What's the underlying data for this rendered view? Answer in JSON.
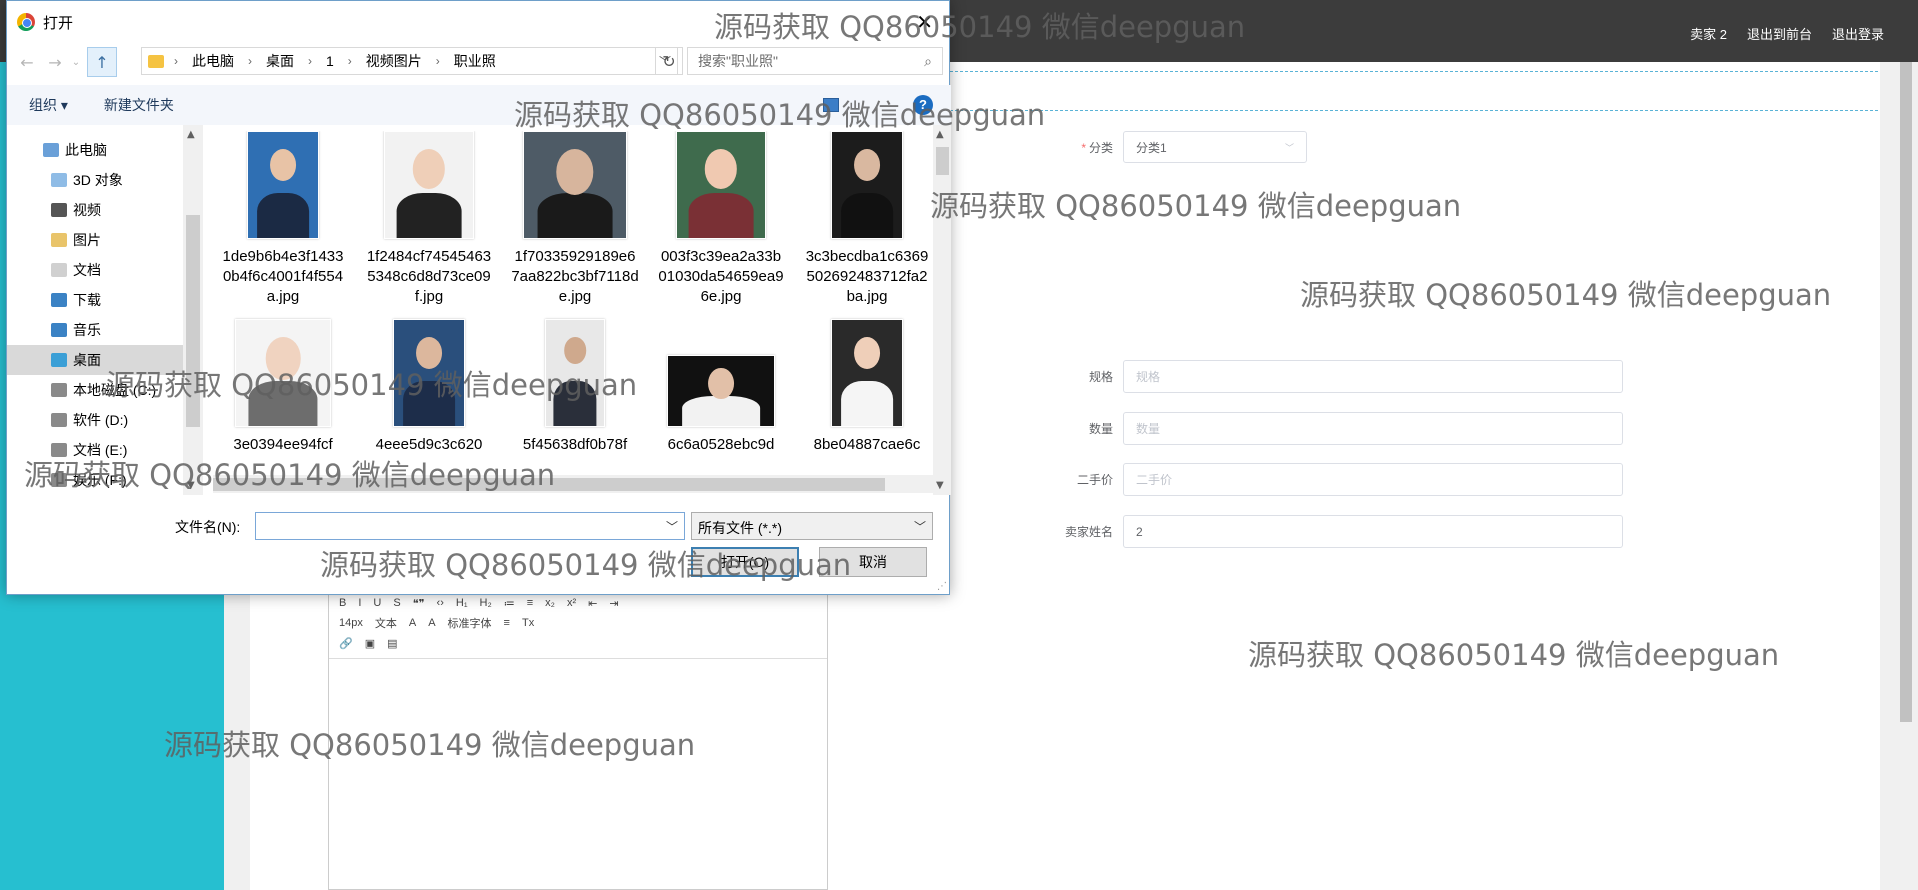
{
  "topbar": {
    "links": [
      "卖家 2",
      "退出到前台",
      "退出登录"
    ]
  },
  "form": {
    "category": {
      "label": "分类",
      "value": "分类1"
    },
    "spec": {
      "label": "规格",
      "placeholder": "规格"
    },
    "quantity": {
      "label": "数量",
      "placeholder": "数量"
    },
    "price": {
      "label": "二手价",
      "placeholder": "二手价"
    },
    "seller": {
      "label": "卖家姓名",
      "value": "2"
    }
  },
  "editor": {
    "row1": [
      "B",
      "I",
      "U",
      "S",
      "❝❞",
      "‹›",
      "H₁",
      "H₂",
      "≔",
      "≡",
      "x₂",
      "x²",
      "⇤",
      "⇥"
    ],
    "row2": [
      "14px",
      "文本",
      "A",
      "A",
      "标准字体",
      "≡",
      "Tx"
    ],
    "row3": [
      "🔗",
      "▣",
      "▤"
    ]
  },
  "dialog": {
    "title": "打开",
    "breadcrumb": [
      "此电脑",
      "桌面",
      "1",
      "视频图片",
      "职业照"
    ],
    "search_placeholder": "搜索\"职业照\"",
    "organize": "组织 ▾",
    "new_folder": "新建文件夹",
    "help": "?",
    "tree": [
      {
        "label": "此电脑",
        "sub": false,
        "color": "#6aa0d8"
      },
      {
        "label": "3D 对象",
        "sub": true,
        "color": "#8fbce6"
      },
      {
        "label": "视频",
        "sub": true,
        "color": "#555555"
      },
      {
        "label": "图片",
        "sub": true,
        "color": "#e9c46a"
      },
      {
        "label": "文档",
        "sub": true,
        "color": "#d0d0d0"
      },
      {
        "label": "下载",
        "sub": true,
        "color": "#3b82c4"
      },
      {
        "label": "音乐",
        "sub": true,
        "color": "#3b82c4"
      },
      {
        "label": "桌面",
        "sub": true,
        "color": "#3b9fd6",
        "selected": true
      },
      {
        "label": "本地磁盘 (C:)",
        "sub": true,
        "color": "#8a8a8a"
      },
      {
        "label": "软件 (D:)",
        "sub": true,
        "color": "#8a8a8a"
      },
      {
        "label": "文档 (E:)",
        "sub": true,
        "color": "#8a8a8a"
      },
      {
        "label": "娱乐 (F:)",
        "sub": true,
        "color": "#8a8a8a"
      }
    ],
    "files": [
      {
        "name": "1de9b6b4e3f14330b4f6c4001f4f554a.jpg",
        "bg": "#2f6fb3",
        "skin": "#e8c3a6",
        "cloth": "#1b2a44"
      },
      {
        "name": "1f2484cf745454635348c6d8d73ce09f.jpg",
        "bg": "#f2f2f2",
        "skin": "#efcfb8",
        "cloth": "#222222"
      },
      {
        "name": "1f70335929189e67aa822bc3bf7118de.jpg",
        "bg": "#4e5b66",
        "skin": "#d7b59d",
        "cloth": "#1a1a1a"
      },
      {
        "name": "003f3c39ea2a33b01030da54659ea96e.jpg",
        "bg": "#3f6b4d",
        "skin": "#f0c9b1",
        "cloth": "#7a3035"
      },
      {
        "name": "3c3becdba1c6369502692483712fa2ba.jpg",
        "bg": "#1c1c1c",
        "skin": "#d9b8a0",
        "cloth": "#111111"
      },
      {
        "name": "3e0394ee94fcf",
        "bg": "#f4f4f4",
        "skin": "#f0d3c0",
        "cloth": "#6d6d6d"
      },
      {
        "name": "4eee5d9c3c620",
        "bg": "#2a4f7c",
        "skin": "#dcb79d",
        "cloth": "#1d2d4a"
      },
      {
        "name": "5f45638df0b78f",
        "bg": "#e8e8e8",
        "skin": "#cfa98d",
        "cloth": "#2a2f3a"
      },
      {
        "name": "6c6a0528ebc9d",
        "bg": "#111111",
        "skin": "#e2c0a8",
        "cloth": "#f2f2f2"
      },
      {
        "name": "8be04887cae6c",
        "bg": "#2a2a2a",
        "skin": "#efcfb9",
        "cloth": "#f5f5f5"
      }
    ],
    "filename_label": "文件名(N):",
    "filename_value": "",
    "filter": "所有文件 (*.*)",
    "open_button": "打开(O)",
    "cancel_button": "取消"
  },
  "watermark": "源码获取 QQ86050149 微信deepguan"
}
